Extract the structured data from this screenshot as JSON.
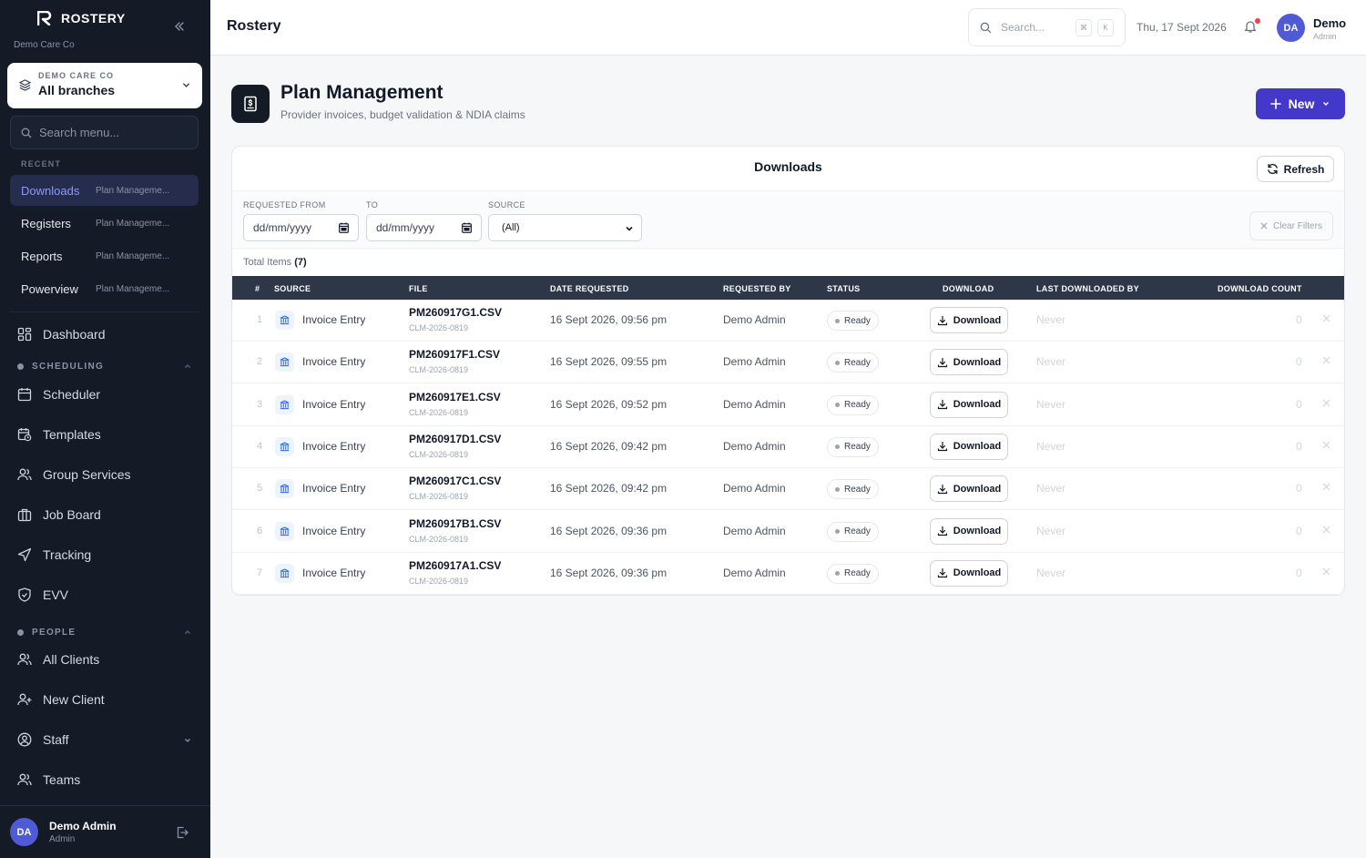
{
  "app": {
    "name": "ROSTERY",
    "org": "Demo Care Co"
  },
  "branch": {
    "label": "DEMO CARE CO",
    "value": "All branches"
  },
  "menu_search": {
    "placeholder": "Search menu..."
  },
  "recent": {
    "title": "RECENT",
    "items": [
      {
        "label": "Downloads",
        "sub": "Plan Manageme..."
      },
      {
        "label": "Registers",
        "sub": "Plan Manageme..."
      },
      {
        "label": "Reports",
        "sub": "Plan Manageme..."
      },
      {
        "label": "Powerview",
        "sub": "Plan Manageme..."
      }
    ]
  },
  "nav": {
    "dashboard": "Dashboard",
    "scheduling": {
      "title": "SCHEDULING",
      "items": [
        "Scheduler",
        "Templates",
        "Group Services",
        "Job Board",
        "Tracking",
        "EVV"
      ]
    },
    "people": {
      "title": "PEOPLE",
      "items": [
        "All Clients",
        "New Client",
        "Staff",
        "Teams"
      ]
    }
  },
  "sidebar_user": {
    "initials": "DA",
    "name": "Demo Admin",
    "role": "Admin"
  },
  "topbar": {
    "title": "Rostery",
    "search_placeholder": "Search...",
    "kbd1": "⌘",
    "kbd2": "K",
    "date": "Thu, 17 Sept 2026",
    "user_initials": "DA",
    "user_name": "Demo",
    "user_role": "Admin"
  },
  "page": {
    "title": "Plan Management",
    "subtitle": "Provider invoices, budget validation & NDIA claims",
    "new_label": "New"
  },
  "card": {
    "title": "Downloads",
    "refresh_label": "Refresh",
    "filters": {
      "from_label": "REQUESTED FROM",
      "from_value": "dd/mm/yyyy",
      "to_label": "TO",
      "to_value": "dd/mm/yyyy",
      "source_label": "SOURCE",
      "source_value": "(All)",
      "clear_label": "Clear Filters"
    },
    "total_label": "Total Items",
    "total_count": "(7)"
  },
  "table": {
    "columns": [
      "#",
      "SOURCE",
      "FILE",
      "DATE REQUESTED",
      "REQUESTED BY",
      "STATUS",
      "DOWNLOAD",
      "LAST DOWNLOADED BY",
      "DOWNLOAD COUNT"
    ],
    "rows": [
      {
        "num": "1",
        "source": "Invoice Entry",
        "file": "PM260917G1.CSV",
        "claim": "CLM-2026-0819",
        "date": "16 Sept 2026, 09:56 pm",
        "by": "Demo Admin",
        "status": "Ready",
        "download": "Download",
        "last": "Never",
        "count": "0"
      },
      {
        "num": "2",
        "source": "Invoice Entry",
        "file": "PM260917F1.CSV",
        "claim": "CLM-2026-0819",
        "date": "16 Sept 2026, 09:55 pm",
        "by": "Demo Admin",
        "status": "Ready",
        "download": "Download",
        "last": "Never",
        "count": "0"
      },
      {
        "num": "3",
        "source": "Invoice Entry",
        "file": "PM260917E1.CSV",
        "claim": "CLM-2026-0819",
        "date": "16 Sept 2026, 09:52 pm",
        "by": "Demo Admin",
        "status": "Ready",
        "download": "Download",
        "last": "Never",
        "count": "0"
      },
      {
        "num": "4",
        "source": "Invoice Entry",
        "file": "PM260917D1.CSV",
        "claim": "CLM-2026-0819",
        "date": "16 Sept 2026, 09:42 pm",
        "by": "Demo Admin",
        "status": "Ready",
        "download": "Download",
        "last": "Never",
        "count": "0"
      },
      {
        "num": "5",
        "source": "Invoice Entry",
        "file": "PM260917C1.CSV",
        "claim": "CLM-2026-0819",
        "date": "16 Sept 2026, 09:42 pm",
        "by": "Demo Admin",
        "status": "Ready",
        "download": "Download",
        "last": "Never",
        "count": "0"
      },
      {
        "num": "6",
        "source": "Invoice Entry",
        "file": "PM260917B1.CSV",
        "claim": "CLM-2026-0819",
        "date": "16 Sept 2026, 09:36 pm",
        "by": "Demo Admin",
        "status": "Ready",
        "download": "Download",
        "last": "Never",
        "count": "0"
      },
      {
        "num": "7",
        "source": "Invoice Entry",
        "file": "PM260917A1.CSV",
        "claim": "CLM-2026-0819",
        "date": "16 Sept 2026, 09:36 pm",
        "by": "Demo Admin",
        "status": "Ready",
        "download": "Download",
        "last": "Never",
        "count": "0"
      }
    ]
  },
  "colors": {
    "sidebar_bg": "#141a26",
    "accent": "#4338ca",
    "active_item": "#8a9aff",
    "table_header": "#2d3748",
    "notification": "#ef4444"
  }
}
